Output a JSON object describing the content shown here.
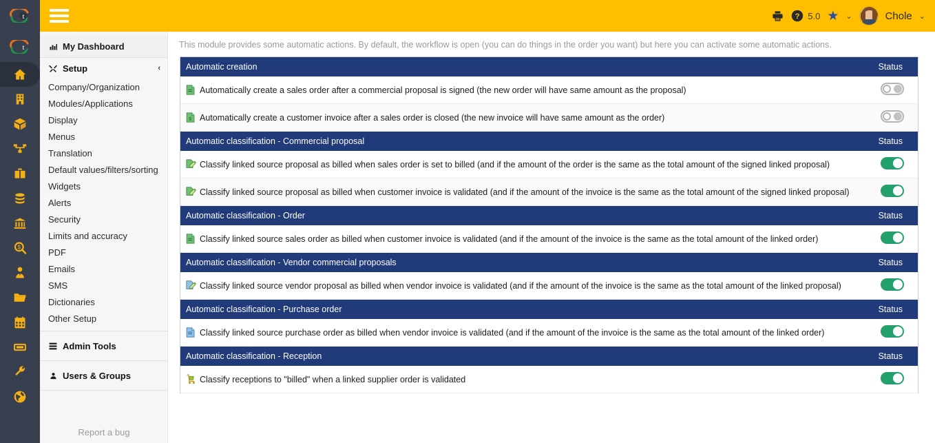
{
  "app": {
    "accent_yellow": "#ffbf00",
    "header_blue": "#203a7a",
    "toggle_on_green": "#23a06b",
    "rail_bg": "#384050"
  },
  "topbar": {
    "menu_icon": "hamburger-icon",
    "print_icon": "printer-icon",
    "help_icon": "question-circle-icon",
    "version": "5.0",
    "star_icon": "star-icon",
    "star_chevron": "⌄",
    "avatar": "user-avatar",
    "user_name": "Chole",
    "user_chevron": "⌄"
  },
  "iconrail": {
    "logo": "logo-icon",
    "items": [
      {
        "name": "home-icon",
        "active": true
      },
      {
        "name": "company-building-icon",
        "active": false
      },
      {
        "name": "products-box-icon",
        "active": false
      },
      {
        "name": "commercial-network-icon",
        "active": false
      },
      {
        "name": "projects-briefcase-icon",
        "active": false
      },
      {
        "name": "accounting-coins-icon",
        "active": false
      },
      {
        "name": "bank-icon",
        "active": false
      },
      {
        "name": "search-money-icon",
        "active": false
      },
      {
        "name": "hrm-user-tie-icon",
        "active": false
      },
      {
        "name": "documents-folder-icon",
        "active": false
      },
      {
        "name": "agenda-calendar-icon",
        "active": false
      },
      {
        "name": "ticket-icon",
        "active": false
      },
      {
        "name": "tools-wrench-icon",
        "active": false
      },
      {
        "name": "globe-icon",
        "active": false
      }
    ]
  },
  "sidebar": {
    "dashboard": {
      "icon": "chart-bar-icon",
      "label": "My Dashboard"
    },
    "setup": {
      "icon": "tools-icon",
      "label": "Setup",
      "chevron": "‹"
    },
    "items": [
      {
        "label": "Company/Organization"
      },
      {
        "label": "Modules/Applications"
      },
      {
        "label": "Display"
      },
      {
        "label": "Menus"
      },
      {
        "label": "Translation"
      },
      {
        "label": "Default values/filters/sorting"
      },
      {
        "label": "Widgets"
      },
      {
        "label": "Alerts"
      },
      {
        "label": "Security"
      },
      {
        "label": "Limits and accuracy"
      },
      {
        "label": "PDF"
      },
      {
        "label": "Emails"
      },
      {
        "label": "SMS"
      },
      {
        "label": "Dictionaries"
      },
      {
        "label": "Other Setup"
      }
    ],
    "admin_tools": {
      "icon": "server-stack-icon",
      "label": "Admin Tools"
    },
    "users_groups": {
      "icon": "user-icon",
      "label": "Users & Groups"
    },
    "report_bug": "Report a bug"
  },
  "main": {
    "intro": "This module provides some automatic actions. By default, the workflow is open (you can do things in the order you want) but here you can activate some automatic actions.",
    "status_label": "Status",
    "groups": [
      {
        "title": "Automatic creation",
        "status_label": "Status",
        "rows": [
          {
            "icon": "document-green-icon",
            "label": "Automatically create a sales order after a commercial proposal is signed (the new order will have same amount as the proposal)",
            "toggle": "off"
          },
          {
            "icon": "invoice-green-icon",
            "label": "Automatically create a customer invoice after a sales order is closed (the new invoice will have same amount as the order)",
            "toggle": "off"
          }
        ]
      },
      {
        "title": "Automatic classification - Commercial proposal",
        "status_label": "Status",
        "rows": [
          {
            "icon": "document-edit-green-icon",
            "label": "Classify linked source proposal as billed when sales order is set to billed (and if the amount of the order is the same as the total amount of the signed linked proposal)",
            "toggle": "on"
          },
          {
            "icon": "document-edit-green-icon",
            "label": "Classify linked source proposal as billed when customer invoice is validated (and if the amount of the invoice is the same as the total amount of the signed linked proposal)",
            "toggle": "on"
          }
        ]
      },
      {
        "title": "Automatic classification - Order",
        "status_label": "Status",
        "rows": [
          {
            "icon": "document-green-icon",
            "label": "Classify linked source sales order as billed when customer invoice is validated (and if the amount of the invoice is the same as the total amount of the linked order)",
            "toggle": "on"
          }
        ]
      },
      {
        "title": "Automatic classification - Vendor commercial proposals",
        "status_label": "Status",
        "rows": [
          {
            "icon": "document-edit-blue-icon",
            "label": "Classify linked source vendor proposal as billed when vendor invoice is validated (and if the amount of the invoice is the same as the total amount of the linked proposal)",
            "toggle": "on"
          }
        ]
      },
      {
        "title": "Automatic classification - Purchase order",
        "status_label": "Status",
        "rows": [
          {
            "icon": "document-blue-icon",
            "label": "Classify linked source purchase order as billed when vendor invoice is validated (and if the amount of the invoice is the same as the total amount of the linked order)",
            "toggle": "on"
          }
        ]
      },
      {
        "title": "Automatic classification - Reception",
        "status_label": "Status",
        "rows": [
          {
            "icon": "dolly-icon",
            "label": "Classify receptions to \"billed\" when a linked supplier order is validated",
            "toggle": "on"
          }
        ]
      }
    ]
  }
}
